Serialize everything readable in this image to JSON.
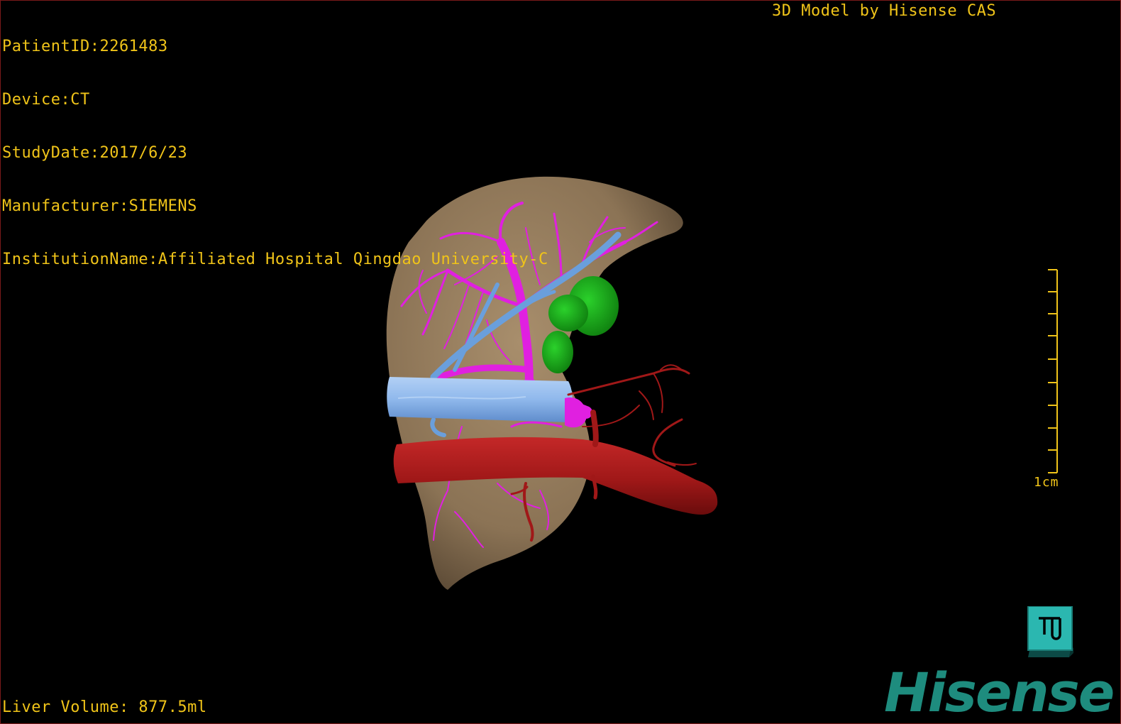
{
  "header": {
    "patient_id": "PatientID:2261483",
    "device": "Device:CT",
    "study_date": "StudyDate:2017/6/23",
    "manufacturer": "Manufacturer:SIEMENS",
    "institution": "InstitutionName:Affiliated Hospital Qingdao University-C",
    "model_credit": "3D Model by Hisense CAS"
  },
  "footer": {
    "liver_volume": "Liver Volume: 877.5ml"
  },
  "scale_bar": {
    "label": "1cm",
    "color": "#f0c419"
  },
  "logo": {
    "text": "Hisense",
    "color": "#1e8c7e"
  },
  "model_colors": {
    "liver": "#8b7355",
    "hepatic_vein": "#6a9fdc",
    "vena_cava": "#8fb8ec",
    "portal_vein": "#e020e0",
    "artery": "#a01818",
    "gallbladder": "#16a416"
  },
  "icons": {
    "view_cube": "view-orientation-cube-icon"
  }
}
